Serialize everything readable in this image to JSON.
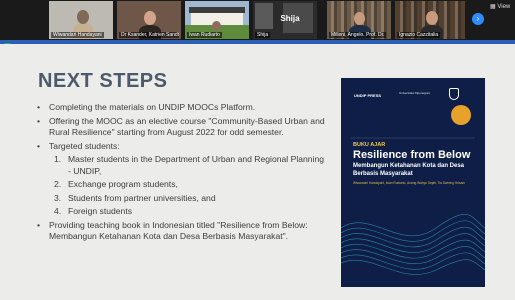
{
  "meeting": {
    "participants": [
      {
        "name": "Wiwandari Handayani",
        "muted": true
      },
      {
        "name": "Dr Ksander, Katrien Sandtorp Pertiet",
        "muted": true
      },
      {
        "name": "Iwan Rudiarto",
        "muted": true
      },
      {
        "name": "Shija",
        "muted": true
      },
      {
        "name": "Shija",
        "muted": false
      },
      {
        "name": "Milleni, Angelo, Prof. Dr.",
        "muted": true
      },
      {
        "name": "Ignazio Cazzitalia",
        "muted": true
      }
    ],
    "shija_big_label": "Shija",
    "next_icon": "chevron-right-icon",
    "view_label": "View",
    "accent": "#2d8cff"
  },
  "slide": {
    "title": "NEXT STEPS",
    "bullets": [
      "Completing the materials on UNDIP MOOCs Platform.",
      "Offering the MOOC as an elective course \"Community-Based Urban and Rural Resilience\" starting from August 2022 for odd semester.",
      "Targeted students:",
      "Providing teaching book in Indonesian titled \"Resilience from Below: Membangun Ketahanan Kota dan Desa Berbasis Masyarakat\"."
    ],
    "sub_items": [
      {
        "num": "1.",
        "text": "Master students in the Department of Urban and Regional Planning - UNDIP,"
      },
      {
        "num": "2.",
        "text": "Exchange program students,"
      },
      {
        "num": "3.",
        "text": "Students from partner universities, and"
      },
      {
        "num": "4.",
        "text": "Foreign students"
      }
    ]
  },
  "book": {
    "press": "UNDIP PRESS",
    "university": "Universitas Diponegoro",
    "label": "BUKU AJAR",
    "title": "Resilience from Below",
    "subtitle": "Membangun Ketahanan Kota dan Desa Berbasis Masyarakat",
    "authors": "Wiwandari Handayani, Iwan Rudiarto, Anang Wahyu Sejati, Tia Dwining Hesam",
    "cover_color": "#0f1e47",
    "accent_color": "#f2c94c"
  }
}
